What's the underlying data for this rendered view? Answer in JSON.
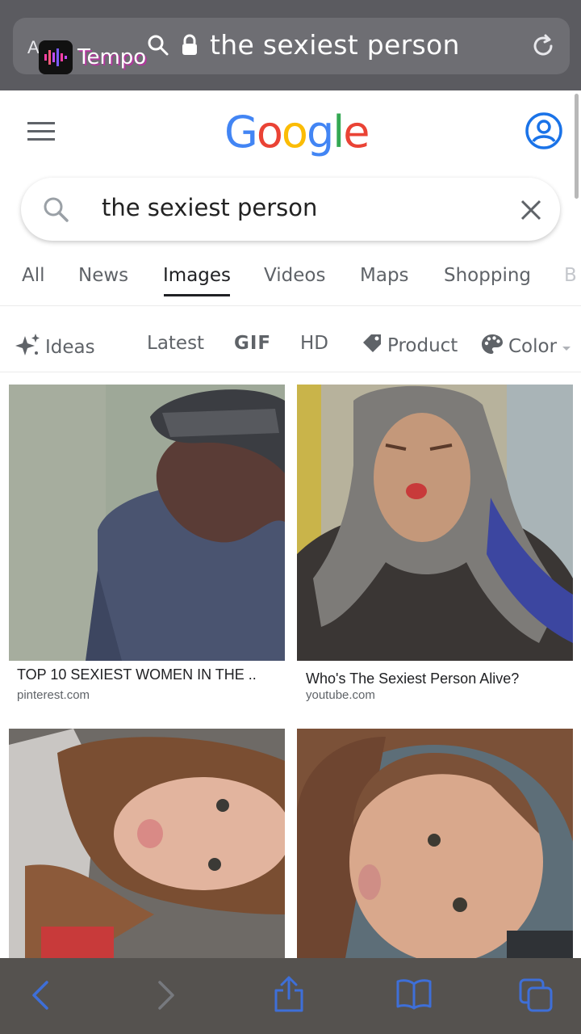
{
  "browser": {
    "aa_label": "AA",
    "url_text": "the sexiest person",
    "overlay_app": "Tempo"
  },
  "google": {
    "logo_letters": [
      {
        "ch": "G",
        "color": "#4285F4"
      },
      {
        "ch": "o",
        "color": "#EA4335"
      },
      {
        "ch": "o",
        "color": "#FBBC05"
      },
      {
        "ch": "g",
        "color": "#4285F4"
      },
      {
        "ch": "l",
        "color": "#34A853"
      },
      {
        "ch": "e",
        "color": "#EA4335"
      }
    ],
    "search_query": "the sexiest person"
  },
  "tabs": {
    "all": "All",
    "news": "News",
    "images": "Images",
    "videos": "Videos",
    "maps": "Maps",
    "shopping": "Shopping",
    "books_partial": "B"
  },
  "filters": {
    "ideas": "Ideas",
    "latest": "Latest",
    "gif": "GIF",
    "hd": "HD",
    "product": "Product",
    "color": "Color"
  },
  "results": [
    {
      "caption": "TOP 10 SEXIEST WOMEN IN THE ..",
      "source": "pinterest.com"
    },
    {
      "caption": "Who's The Sexiest Person Alive?",
      "source": "youtube.com"
    },
    {
      "caption": "",
      "source": ""
    },
    {
      "caption": "",
      "source": ""
    }
  ],
  "colors": {
    "safari_bar": "#5b5b60",
    "link_blue": "#1a73e8",
    "toolbar_icon_blue": "#3e6fd8"
  },
  "icons": [
    "search-icon",
    "lock-icon",
    "reload-icon",
    "menu-icon",
    "account-icon",
    "clear-icon",
    "sparkle-icon",
    "tag-icon",
    "palette-icon",
    "back-icon",
    "forward-icon",
    "share-icon",
    "bookmarks-icon",
    "tabs-icon"
  ]
}
